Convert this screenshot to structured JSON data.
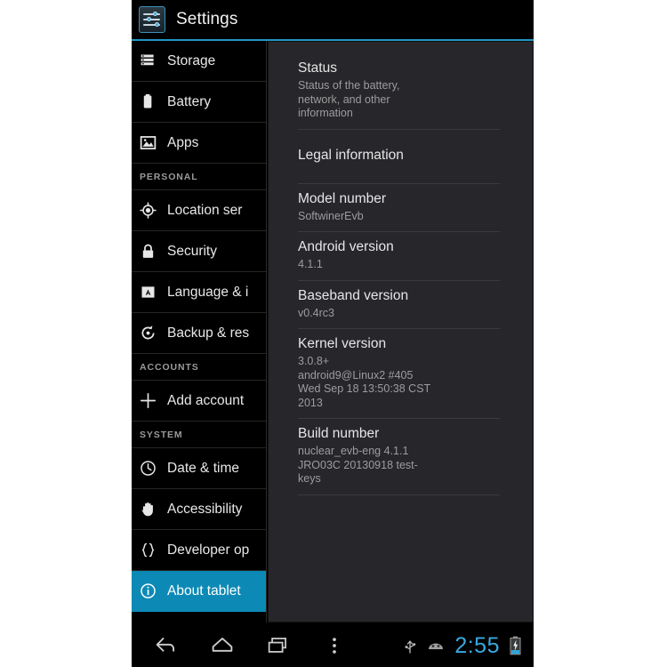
{
  "window": {
    "app_title": "Settings",
    "app_icon": "sliders-icon",
    "accent_color": "#2196c4",
    "selected_color": "#0c8ab5",
    "panel_bg": "#26262b"
  },
  "sidebar": {
    "items": [
      {
        "type": "item",
        "label": "Storage",
        "icon": "storage-icon",
        "selected": false
      },
      {
        "type": "item",
        "label": "Battery",
        "icon": "battery-icon",
        "selected": false
      },
      {
        "type": "item",
        "label": "Apps",
        "icon": "apps-image-icon",
        "selected": false
      },
      {
        "type": "header",
        "label": "PERSONAL"
      },
      {
        "type": "item",
        "label": "Location ser",
        "icon": "location-icon",
        "selected": false
      },
      {
        "type": "item",
        "label": "Security",
        "icon": "lock-icon",
        "selected": false
      },
      {
        "type": "item",
        "label": "Language & i",
        "icon": "language-icon",
        "selected": false
      },
      {
        "type": "item",
        "label": "Backup & res",
        "icon": "backup-reset-icon",
        "selected": false
      },
      {
        "type": "header",
        "label": "ACCOUNTS"
      },
      {
        "type": "item",
        "label": "Add account",
        "icon": "plus-icon",
        "selected": false
      },
      {
        "type": "header",
        "label": "SYSTEM"
      },
      {
        "type": "item",
        "label": "Date & time",
        "icon": "clock-icon",
        "selected": false
      },
      {
        "type": "item",
        "label": "Accessibility",
        "icon": "hand-icon",
        "selected": false
      },
      {
        "type": "item",
        "label": "Developer op",
        "icon": "braces-icon",
        "selected": false
      },
      {
        "type": "item",
        "label": "About tablet",
        "icon": "info-icon",
        "selected": true
      }
    ]
  },
  "content": {
    "rows": [
      {
        "title": "Status",
        "sub": "Status of the battery,\nnetwork, and other\ninformation"
      },
      {
        "title": "Legal information",
        "sub": ""
      },
      {
        "title": "Model number",
        "sub": "SoftwinerEvb"
      },
      {
        "title": "Android version",
        "sub": "4.1.1"
      },
      {
        "title": "Baseband version",
        "sub": "v0.4rc3"
      },
      {
        "title": "Kernel version",
        "sub": "3.0.8+\nandroid9@Linux2 #405\nWed Sep 18 13:50:38 CST\n2013"
      },
      {
        "title": "Build number",
        "sub": "nuclear_evb-eng 4.1.1\nJRO03C 20130918 test-\nkeys"
      }
    ]
  },
  "navbar": {
    "back": "back-icon",
    "home": "home-icon",
    "recents": "recents-icon",
    "menu": "overflow-menu-icon",
    "usb": "usb-icon",
    "adb": "android-debug-icon",
    "clock": "2:55",
    "clock_color": "#37a9e0",
    "battery": "battery-charging-icon"
  }
}
